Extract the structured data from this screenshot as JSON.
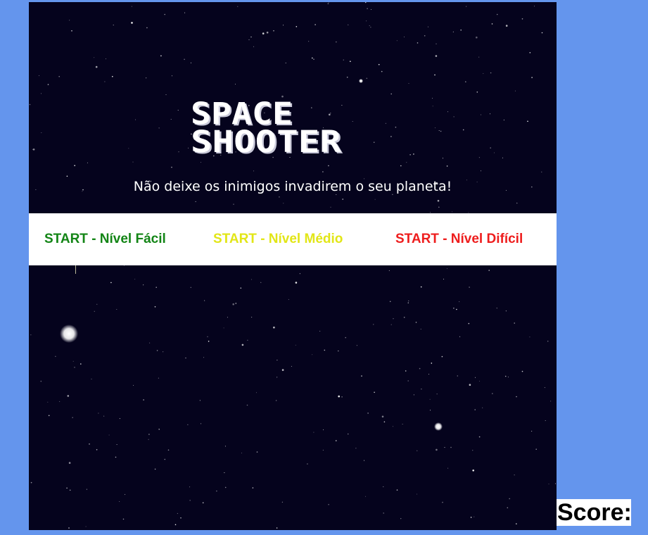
{
  "game": {
    "title_line1": "SPACE",
    "title_line2": "SHOOTER",
    "tagline": "Não deixe os inimigos invadirem o seu planeta!"
  },
  "menu": {
    "easy_label": "START - Nível Fácil",
    "medium_label": "START - Nível Médio",
    "hard_label": "START - Nível Difícil"
  },
  "score": {
    "label": "Score:"
  },
  "colors": {
    "page_background": "#6495ed",
    "space_background": "#05031d",
    "easy": "#138516",
    "medium": "#e2e617",
    "hard": "#ee1d1d"
  }
}
